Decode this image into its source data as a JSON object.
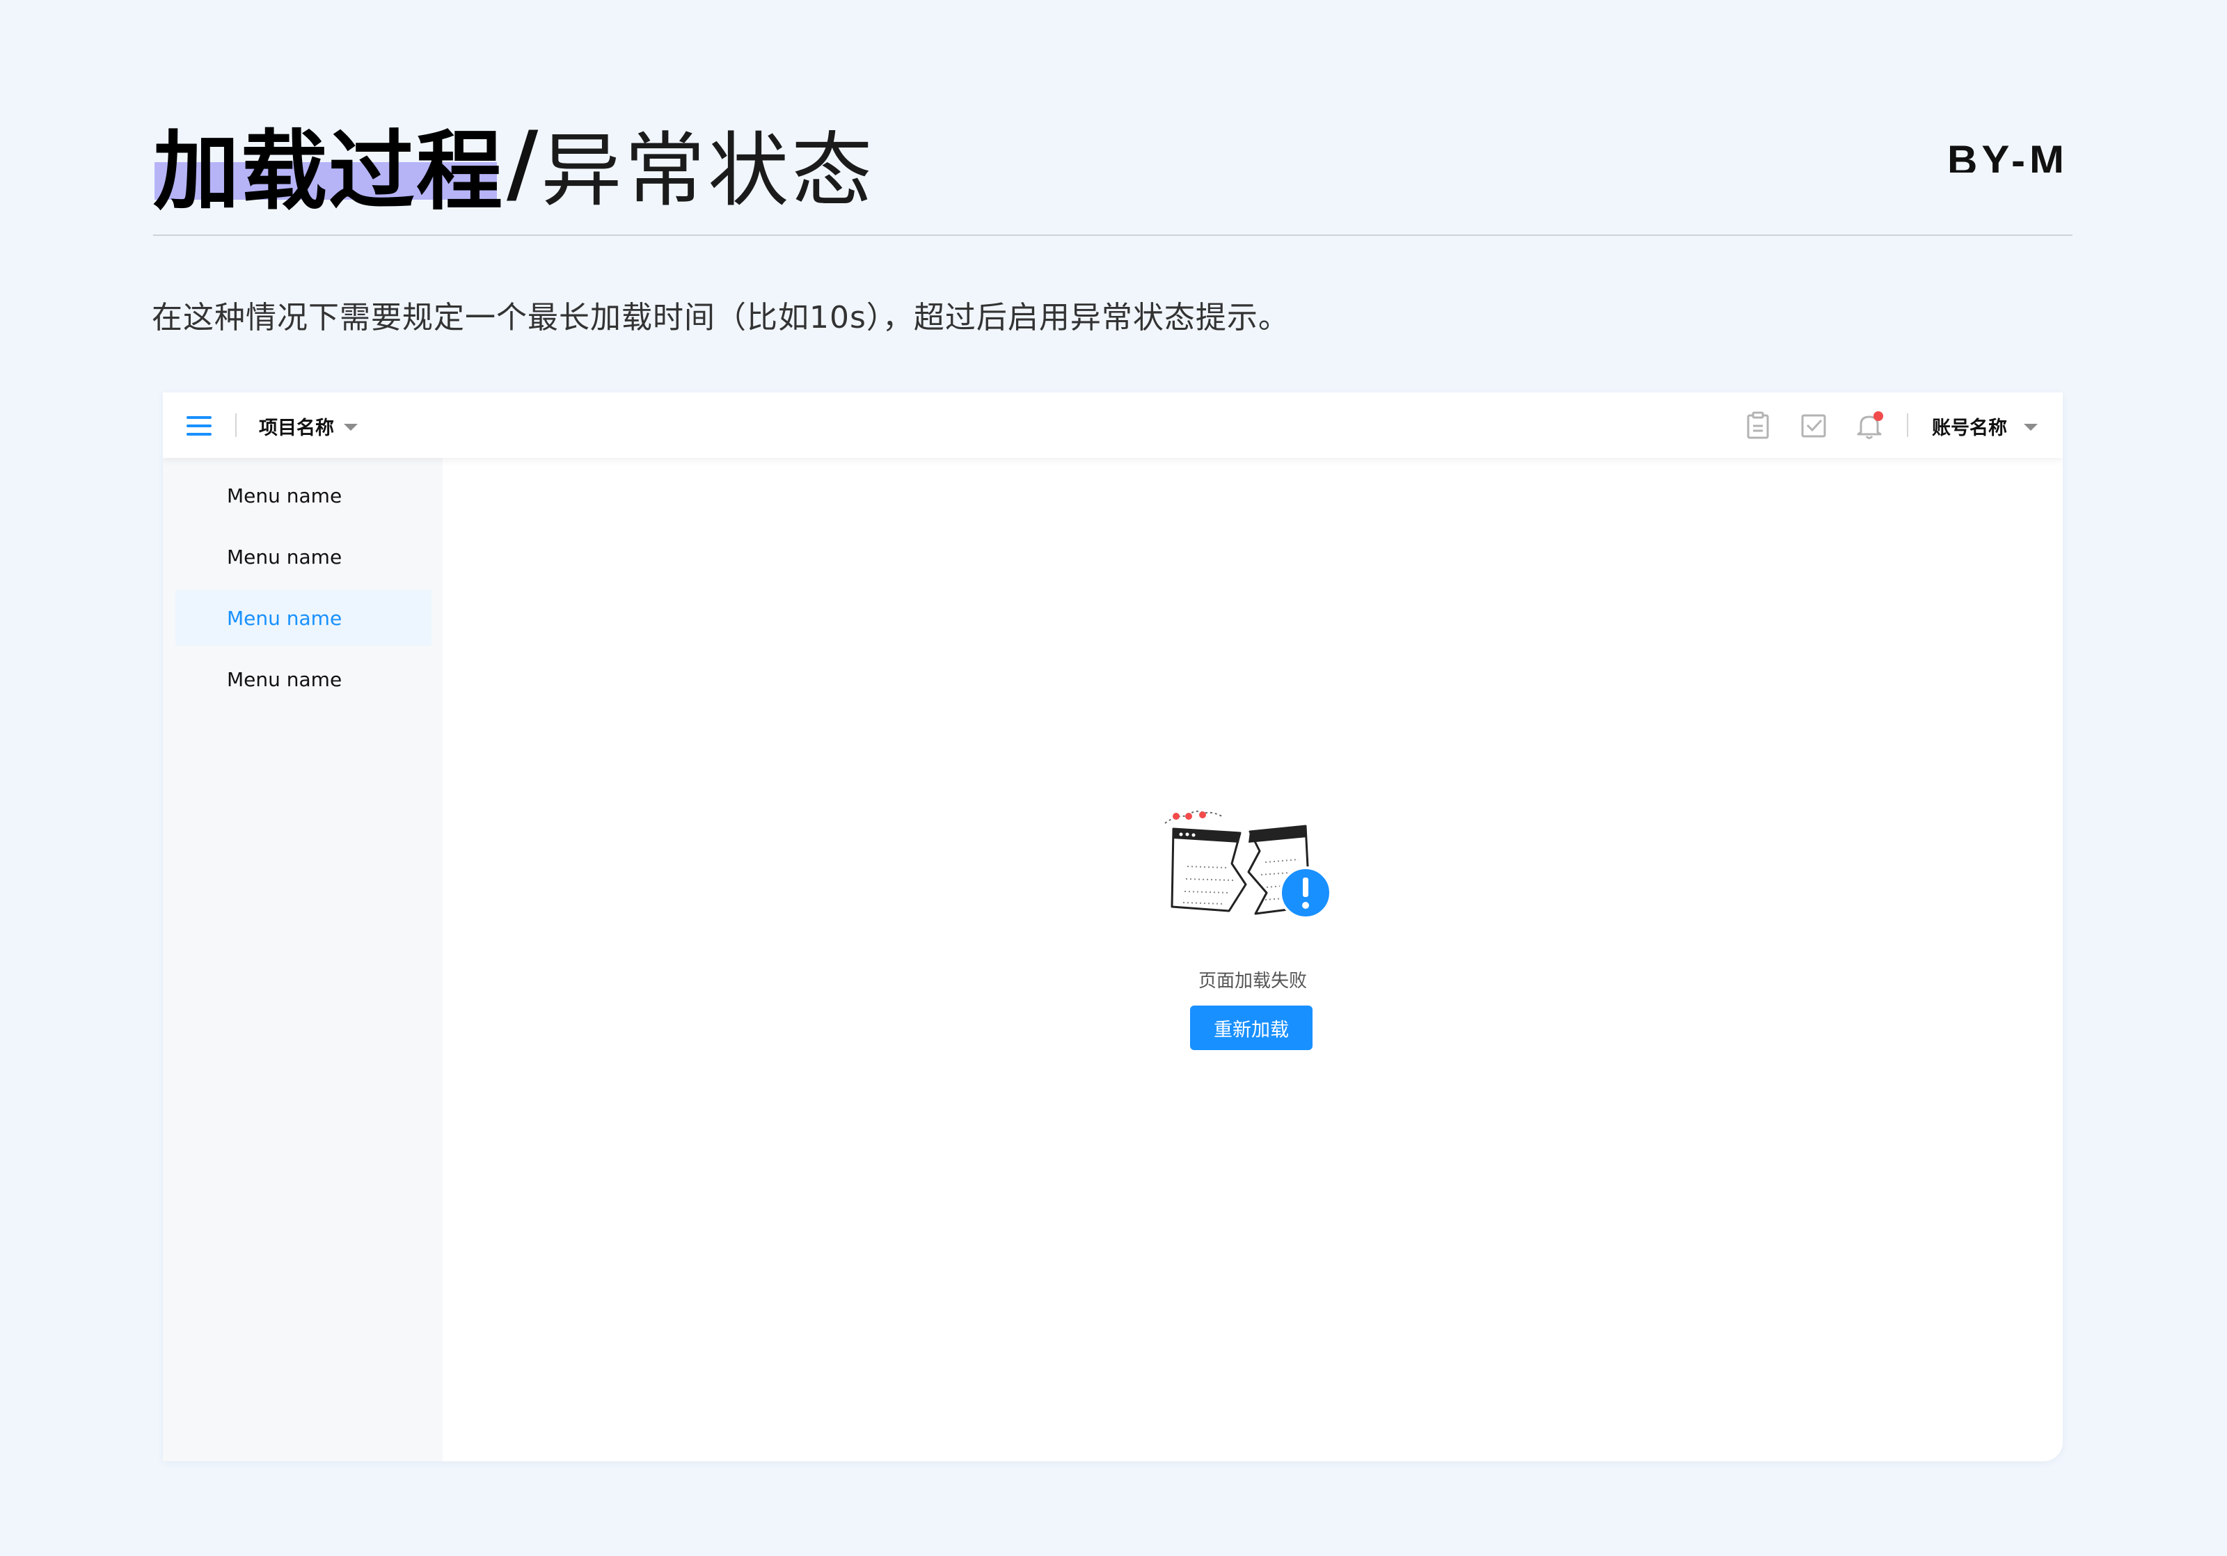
{
  "heading": {
    "bold": "加载过程",
    "slash": "/",
    "light": "异常状态",
    "brand": "BY-M"
  },
  "subtitle": "在这种情况下需要规定一个最长加载时间（比如10s），超过后启用异常状态提示。",
  "topbar": {
    "project_name": "项目名称",
    "account_name": "账号名称",
    "icons": [
      "menu-icon",
      "clipboard-icon",
      "checkbox-icon",
      "bell-icon"
    ],
    "notification_dot": true
  },
  "sidebar": {
    "items": [
      {
        "label": "Menu name",
        "active": false
      },
      {
        "label": "Menu name",
        "active": false
      },
      {
        "label": "Menu name",
        "active": true
      },
      {
        "label": "Menu name",
        "active": false
      }
    ]
  },
  "error_state": {
    "message": "页面加载失败",
    "button": "重新加载"
  },
  "colors": {
    "background": "#f1f6fd",
    "accent": "#1890ff",
    "highlight": "#b6b4f7",
    "alert_red": "#f24b4b"
  }
}
